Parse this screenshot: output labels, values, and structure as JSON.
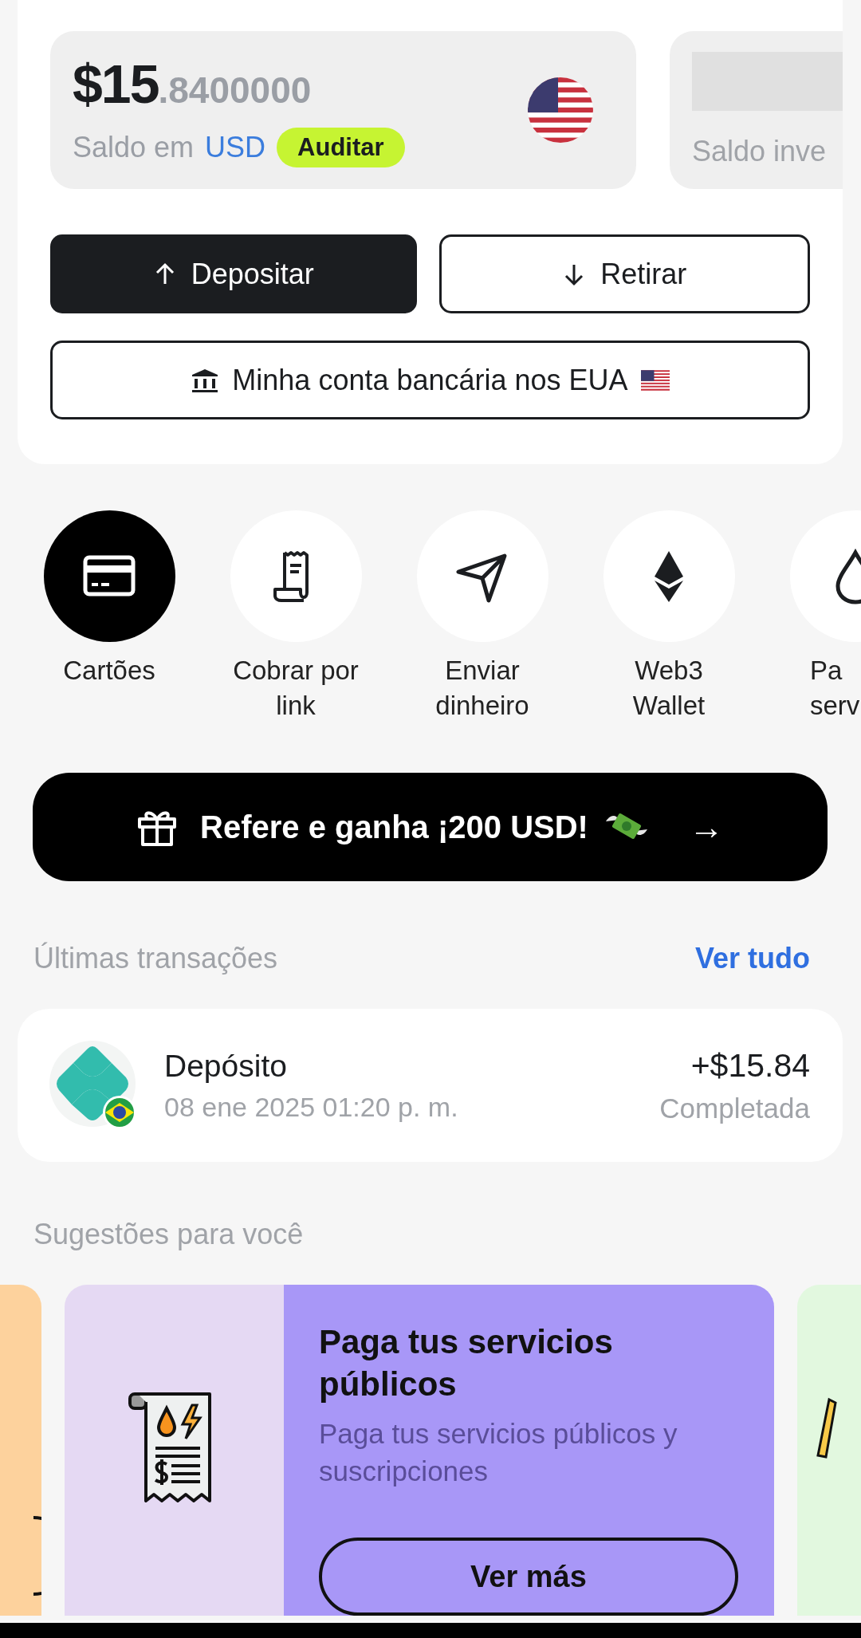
{
  "balance": {
    "integer": "$15",
    "decimals": ".8400000",
    "label": "Saldo em",
    "currency": "USD",
    "badge": "Auditar"
  },
  "secondary_balance": {
    "label": "Saldo inve"
  },
  "buttons": [
    {
      "kind": "deposit",
      "label": "Depositar"
    },
    {
      "kind": "withdraw",
      "label": "Retirar"
    }
  ],
  "bank_account_button": {
    "label": "Minha conta bancária nos EUA"
  },
  "actions": [
    {
      "label": "Cartões",
      "highlighted": true
    },
    {
      "label": "Cobrar por\nlink",
      "highlighted": false
    },
    {
      "label": "Enviar\ndinheiro",
      "highlighted": false
    },
    {
      "label": "Web3\nWallet",
      "highlighted": false
    },
    {
      "label": "Pa\nserv",
      "highlighted": false
    }
  ],
  "referral_banner": {
    "label": "Refere e ganha ¡200 USD!",
    "arrow": "→"
  },
  "transactions": {
    "title": "Últimas transações",
    "see_all": "Ver tudo",
    "items": [
      {
        "title": "Depósito",
        "date": "08 ene 2025 01:20 p. m.",
        "amount": "+$15.84",
        "status": "Completada"
      }
    ]
  },
  "suggestions": {
    "title": "Sugestões para você",
    "cards": [
      {
        "kind": "partial",
        "color": "#fdd29d"
      },
      {
        "kind": "full",
        "title": "Paga tus servicios públicos",
        "description": "Paga tus servicios públicos y suscripciones",
        "button": "Ver más"
      },
      {
        "kind": "partial",
        "color": "#e2f8df"
      }
    ]
  }
}
